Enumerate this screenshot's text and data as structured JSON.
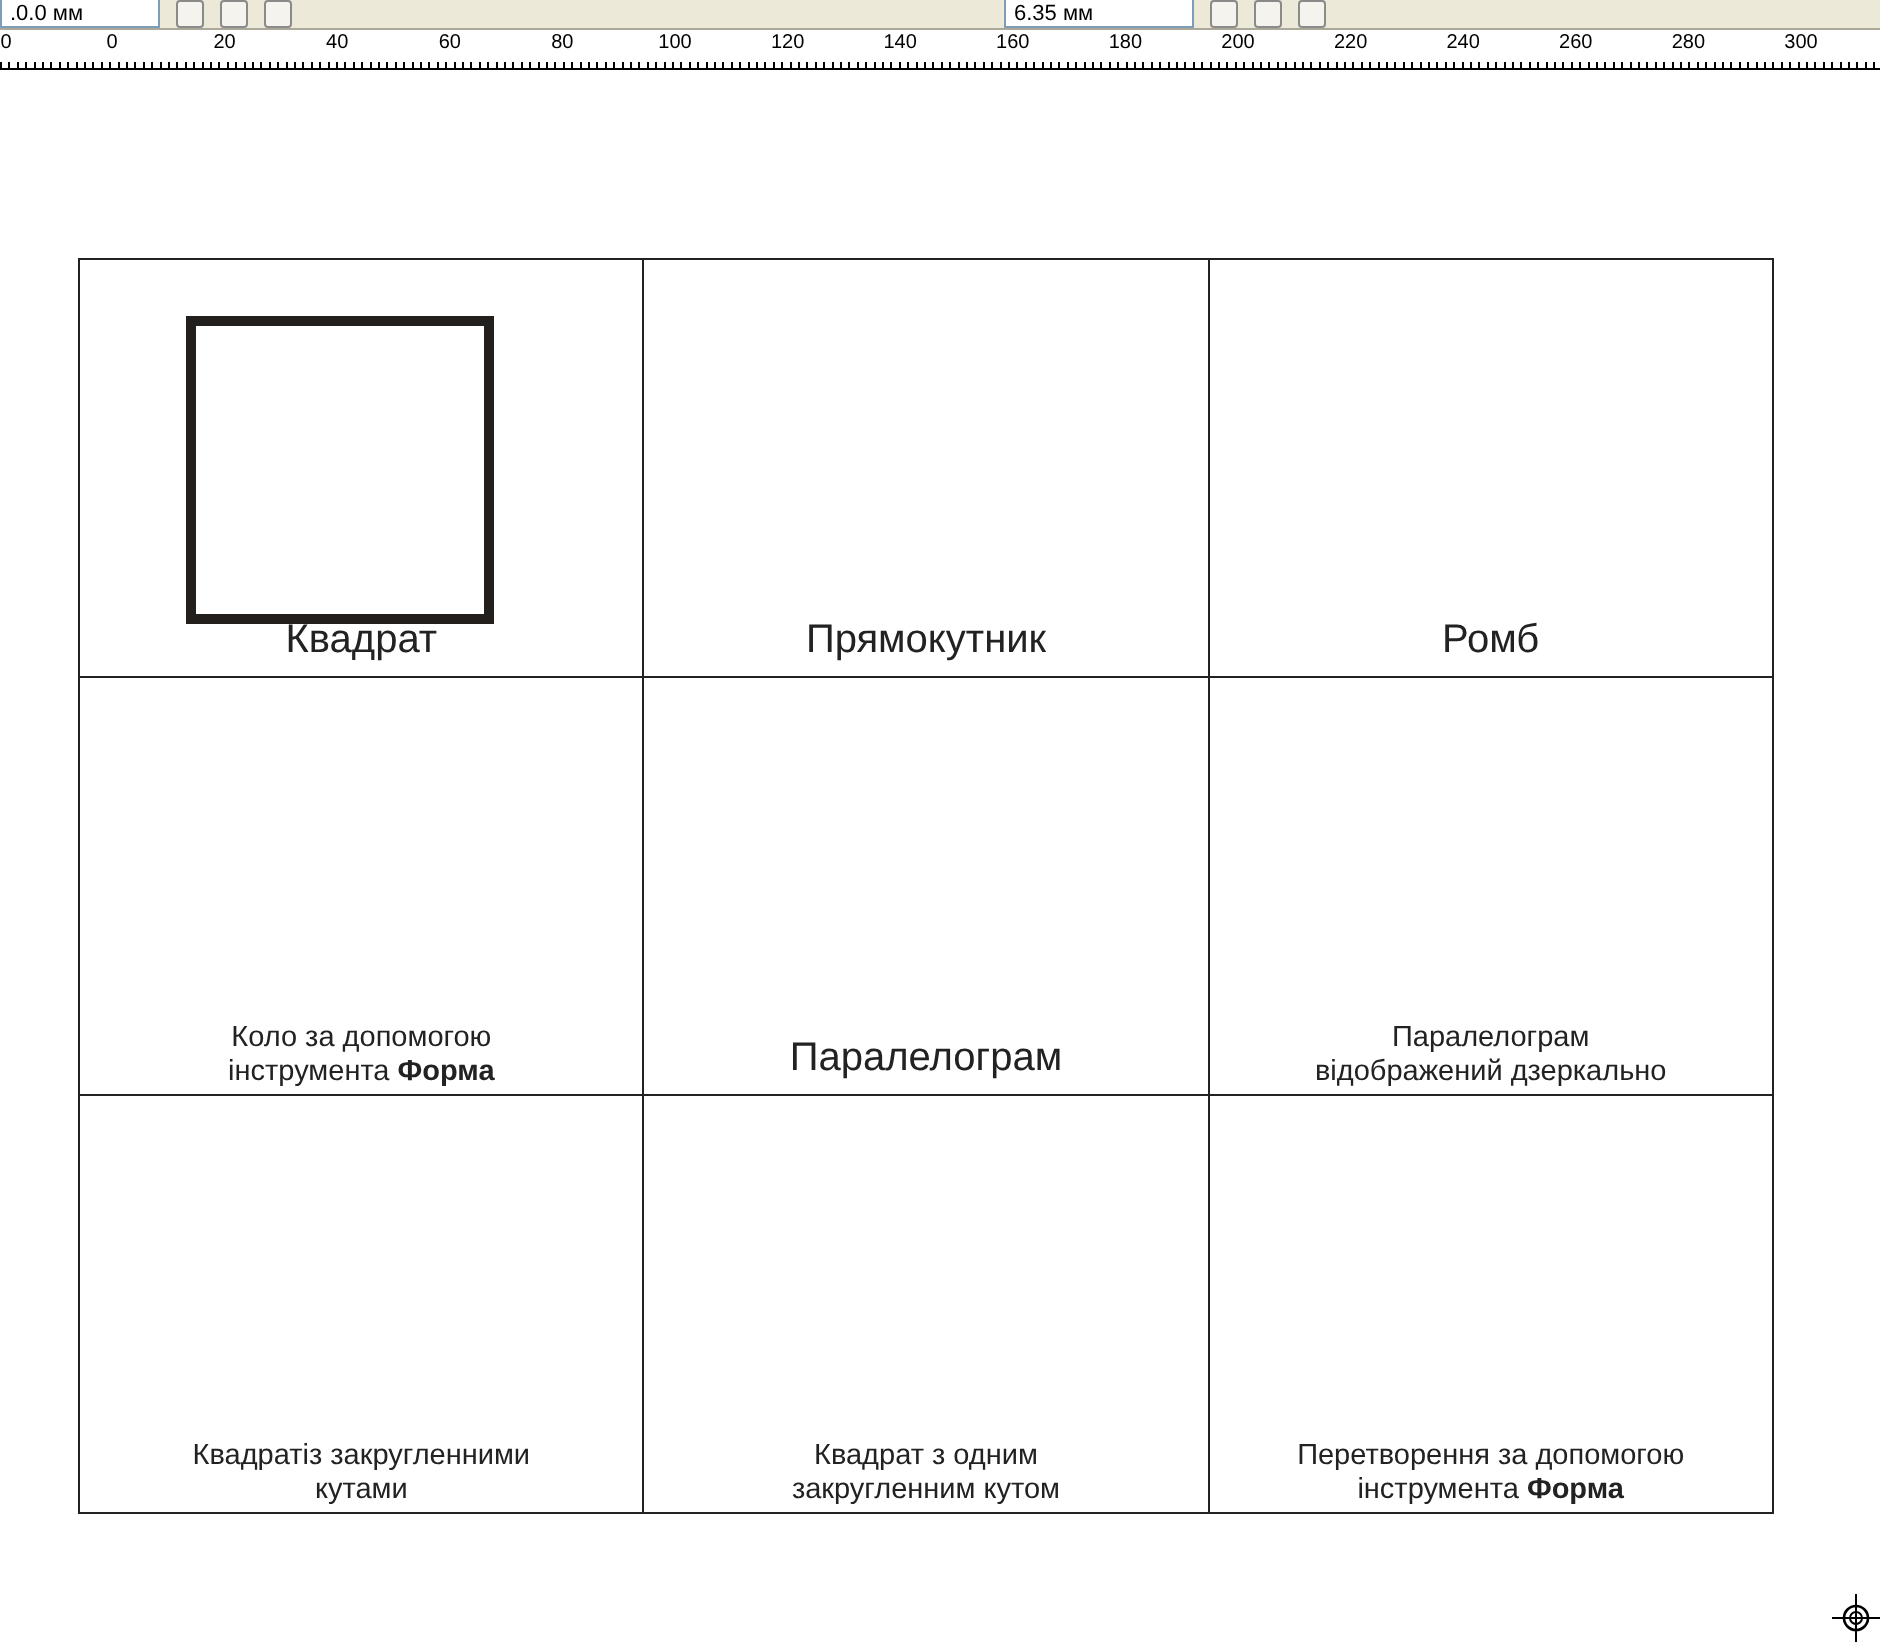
{
  "toolbar": {
    "fields": [
      {
        "value": ".0.0 мм"
      },
      {
        "value": "6.35 мм"
      }
    ]
  },
  "ruler": {
    "labels": [
      "0",
      "0",
      "20",
      "40",
      "60",
      "80",
      "100",
      "120",
      "140",
      "160",
      "180",
      "200",
      "220",
      "240",
      "260",
      "280",
      "300"
    ]
  },
  "grid": {
    "cells": [
      {
        "kind": "title",
        "caption": "Квадрат",
        "square": true
      },
      {
        "kind": "title",
        "caption": "Прямокутник"
      },
      {
        "kind": "title",
        "caption": "Ромб"
      },
      {
        "kind": "note",
        "caption": "Коло за допомогою\nінструмента **Форма**"
      },
      {
        "kind": "title",
        "caption": "Паралелограм"
      },
      {
        "kind": "note",
        "caption": "Паралелограм\nвідображений дзеркально"
      },
      {
        "kind": "note",
        "caption": "Квадратіз закругленними\nкутами"
      },
      {
        "kind": "note",
        "caption": "Квадрат з одним\nзакругленним кутом"
      },
      {
        "kind": "note",
        "caption": "Перетворення за допомогою\nінструмента **Форма**"
      }
    ]
  }
}
